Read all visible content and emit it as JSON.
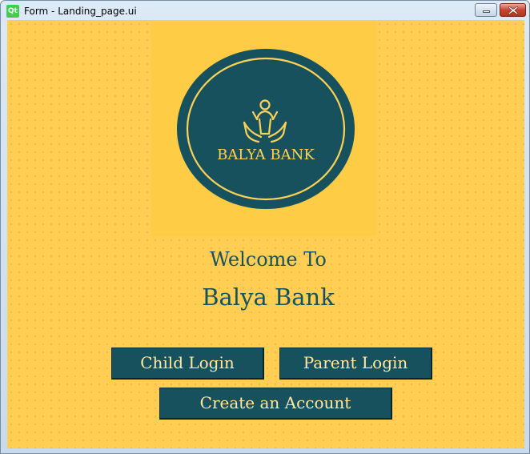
{
  "window": {
    "title": "Form - Landing_page.ui",
    "app_icon_label": "Qt",
    "app_icon": "qt-logo-icon",
    "controls": [
      "minimize-icon",
      "close-icon"
    ]
  },
  "logo": {
    "text": "BALYA BANK",
    "icon": "child-in-hands-icon",
    "colors": {
      "circle": "#17515e",
      "ring": "#ffd256",
      "background": "#ffcc45"
    }
  },
  "welcome": {
    "line1": "Welcome To",
    "line2": "Balya Bank"
  },
  "buttons": {
    "child_login": "Child Login",
    "parent_login": "Parent Login",
    "create_account": "Create an Account"
  },
  "theme": {
    "background": "#ffce52",
    "accent": "#17515e",
    "button_text": "#ffe8a4"
  }
}
